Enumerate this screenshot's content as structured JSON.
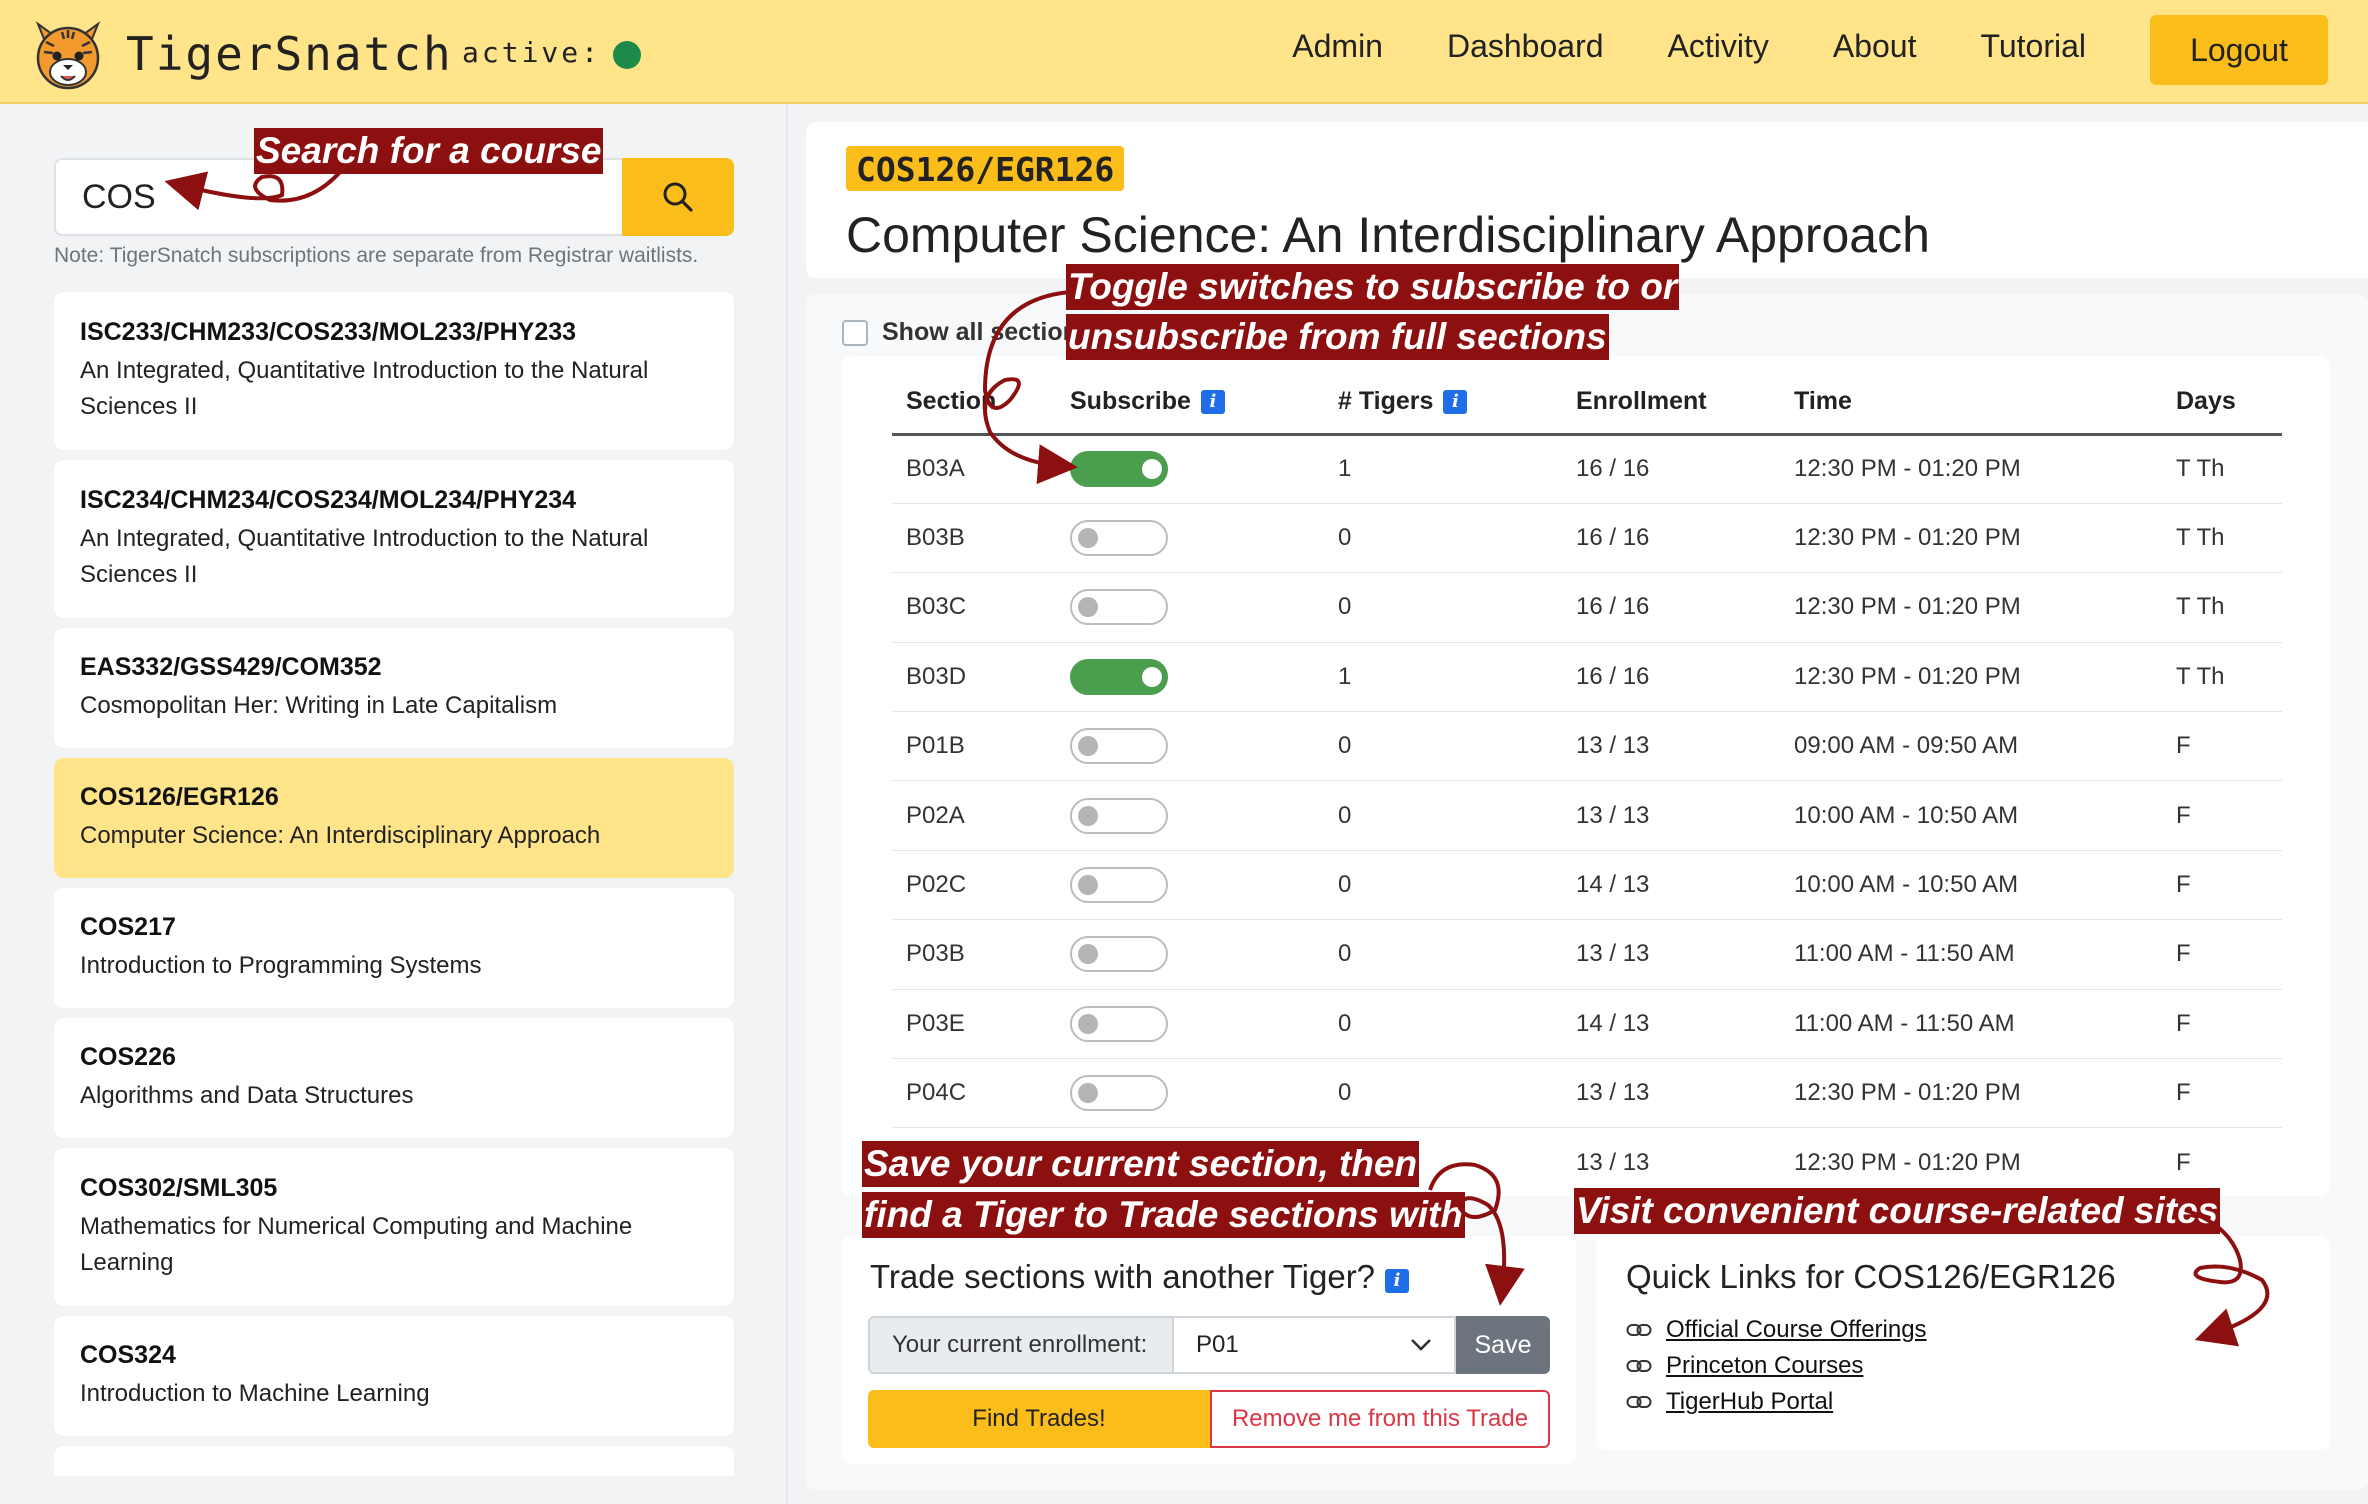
{
  "navbar": {
    "brand": "TigerSnatch",
    "active_label": "active:",
    "links": [
      "Admin",
      "Dashboard",
      "Activity",
      "About",
      "Tutorial"
    ],
    "logout": "Logout"
  },
  "search": {
    "value": "COS",
    "note": "Note: TigerSnatch subscriptions are separate from Registrar waitlists."
  },
  "courses": [
    {
      "code": "ISC233/CHM233/COS233/MOL233/PHY233",
      "title": "An Integrated, Quantitative Introduction to the Natural Sciences II"
    },
    {
      "code": "ISC234/CHM234/COS234/MOL234/PHY234",
      "title": "An Integrated, Quantitative Introduction to the Natural Sciences II"
    },
    {
      "code": "EAS332/GSS429/COM352",
      "title": "Cosmopolitan Her: Writing in Late Capitalism"
    },
    {
      "code": "COS126/EGR126",
      "title": "Computer Science: An Interdisciplinary Approach"
    },
    {
      "code": "COS217",
      "title": "Introduction to Programming Systems"
    },
    {
      "code": "COS226",
      "title": "Algorithms and Data Structures"
    },
    {
      "code": "COS302/SML305",
      "title": "Mathematics for Numerical Computing and Machine Learning"
    },
    {
      "code": "COS324",
      "title": "Introduction to Machine Learning"
    }
  ],
  "course": {
    "code": "COS126/EGR126",
    "title": "Computer Science: An Interdisciplinary Approach"
  },
  "sections_table": {
    "show_all": "Show all sections",
    "headers": [
      "Section",
      "Subscribe",
      "# Tigers",
      "Enrollment",
      "Time",
      "Days"
    ],
    "rows": [
      {
        "section": "B03A",
        "on": true,
        "tigers": "1",
        "enrollment": "16 / 16",
        "time": "12:30 PM - 01:20 PM",
        "days": "T Th"
      },
      {
        "section": "B03B",
        "on": false,
        "tigers": "0",
        "enrollment": "16 / 16",
        "time": "12:30 PM - 01:20 PM",
        "days": "T Th"
      },
      {
        "section": "B03C",
        "on": false,
        "tigers": "0",
        "enrollment": "16 / 16",
        "time": "12:30 PM - 01:20 PM",
        "days": "T Th"
      },
      {
        "section": "B03D",
        "on": true,
        "tigers": "1",
        "enrollment": "16 / 16",
        "time": "12:30 PM - 01:20 PM",
        "days": "T Th"
      },
      {
        "section": "P01B",
        "on": false,
        "tigers": "0",
        "enrollment": "13 / 13",
        "time": "09:00 AM - 09:50 AM",
        "days": "F"
      },
      {
        "section": "P02A",
        "on": false,
        "tigers": "0",
        "enrollment": "13 / 13",
        "time": "10:00 AM - 10:50 AM",
        "days": "F"
      },
      {
        "section": "P02C",
        "on": false,
        "tigers": "0",
        "enrollment": "14 / 13",
        "time": "10:00 AM - 10:50 AM",
        "days": "F"
      },
      {
        "section": "P03B",
        "on": false,
        "tigers": "0",
        "enrollment": "13 / 13",
        "time": "11:00 AM - 11:50 AM",
        "days": "F"
      },
      {
        "section": "P03E",
        "on": false,
        "tigers": "0",
        "enrollment": "14 / 13",
        "time": "11:00 AM - 11:50 AM",
        "days": "F"
      },
      {
        "section": "P04C",
        "on": false,
        "tigers": "0",
        "enrollment": "13 / 13",
        "time": "12:30 PM - 01:20 PM",
        "days": "F"
      },
      {
        "section": "",
        "on": null,
        "tigers": "",
        "enrollment": "13 / 13",
        "time": "12:30 PM - 01:20 PM",
        "days": "F"
      }
    ]
  },
  "trade": {
    "title": "Trade sections with another Tiger?",
    "label": "Your current enrollment:",
    "selected": "P01",
    "save": "Save",
    "find": "Find Trades!",
    "remove": "Remove me from this Trade"
  },
  "quick_links": {
    "title": "Quick Links for COS126/EGR126",
    "links": [
      "Official Course Offerings",
      "Princeton Courses",
      "TigerHub Portal"
    ]
  },
  "annotations": {
    "search": "Search for a course",
    "toggle_line1": "Toggle switches to subscribe to or",
    "toggle_line2": "unsubscribe from full sections",
    "save_line1": "Save your current section, then",
    "save_line2": "find a Tiger to Trade sections with",
    "links": "Visit convenient course-related sites"
  },
  "colors": {
    "navbar": "#ffe48a",
    "accent": "#fbbd19",
    "toggle_on": "#4a9e4e",
    "annotation": "#8d1010",
    "danger": "#dc3545"
  }
}
